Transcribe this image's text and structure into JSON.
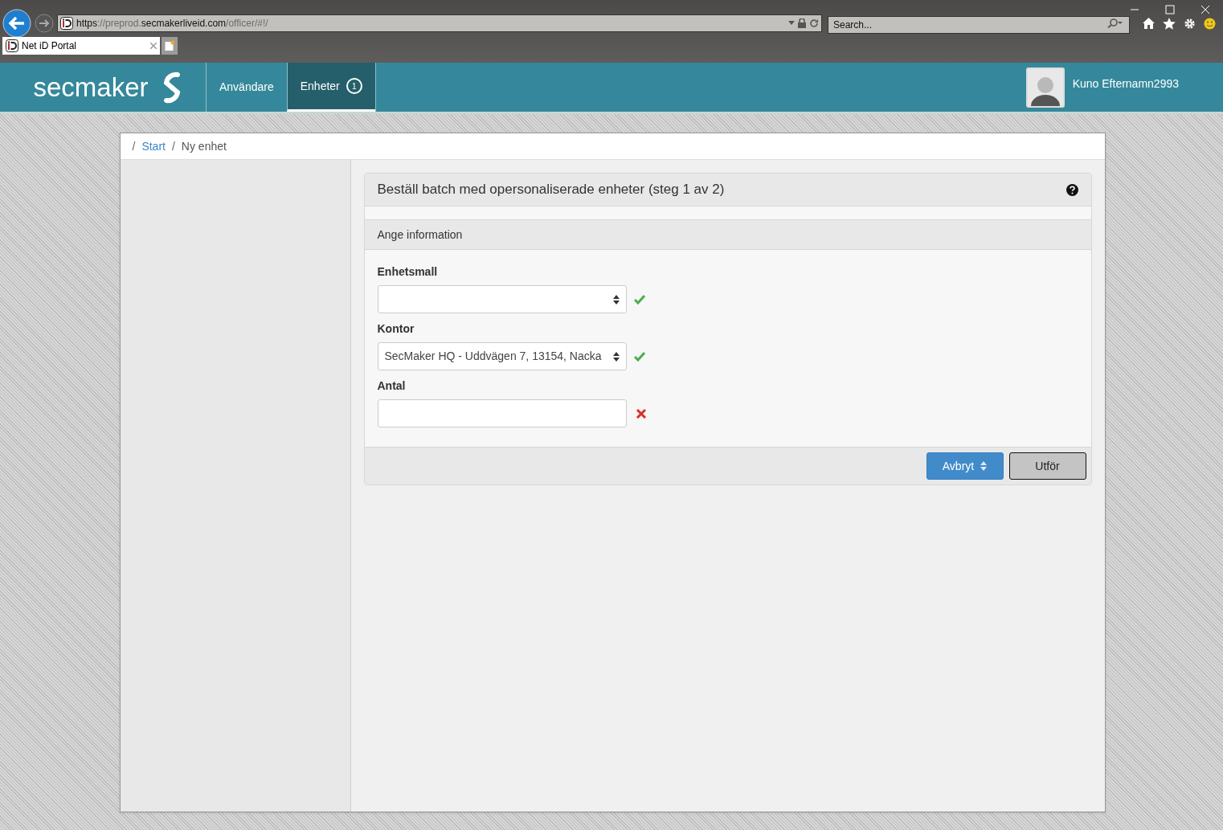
{
  "browser": {
    "address_parts": [
      {
        "text": "https",
        "strong": true
      },
      {
        "text": "://preprod.",
        "strong": false
      },
      {
        "text": "secmakerliveid.com",
        "strong": true
      },
      {
        "text": "/officer/#!/",
        "strong": false
      }
    ],
    "search": {
      "placeholder": "Search..."
    },
    "tabs": [
      {
        "label": "Net iD Portal",
        "selected": true
      }
    ]
  },
  "nav": {
    "logo": "secmaker",
    "items": [
      {
        "label": "Användare",
        "selected": false
      },
      {
        "label": "Enheter",
        "badge": "1",
        "selected": true
      }
    ],
    "user": "Kuno Efternamn2993"
  },
  "breadcrumb": [
    {
      "separator": "/",
      "label": "Start",
      "link": true
    },
    {
      "separator": "/",
      "label": "Ny enhet",
      "link": false
    }
  ],
  "panel": {
    "title": "Beställ batch med opersonaliserade enheter (steg 1 av 2)",
    "section": "Ange information",
    "fields": [
      {
        "label": "Enhetsmall",
        "kind": "select",
        "valid": true
      },
      {
        "label": "Kontor",
        "kind": "select",
        "value": "SecMaker HQ - Uddvägen 7, 13154, Nacka",
        "valid": true
      },
      {
        "label": "Antal",
        "kind": "input",
        "valid": false
      }
    ],
    "buttons": [
      {
        "label": "Avbryt",
        "kind": "primary"
      },
      {
        "label": "Utför",
        "kind": "default"
      }
    ]
  }
}
